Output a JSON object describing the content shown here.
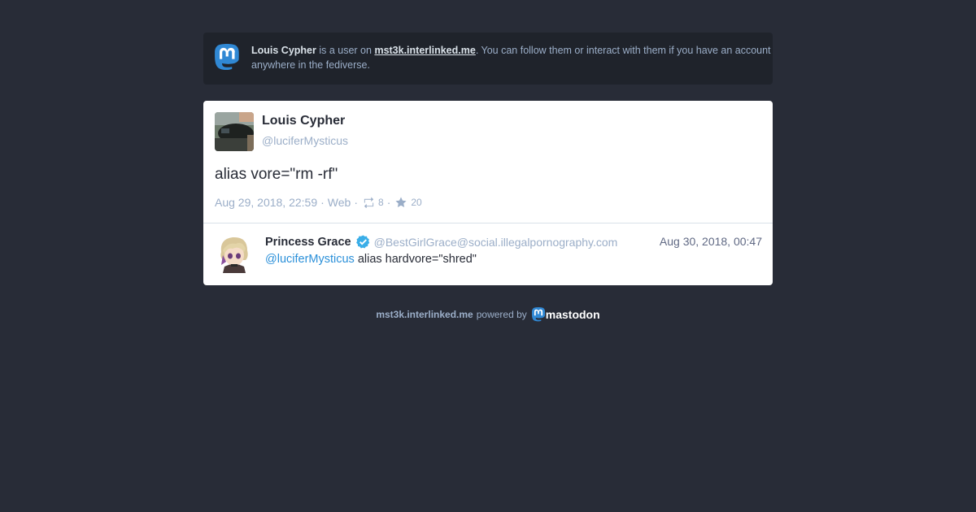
{
  "notice": {
    "name": "Louis Cypher",
    "text_middle": " is a user on ",
    "domain": "mst3k.interlinked.me",
    "text_end": ". You can follow them or interact with them if you have an account anywhere in the fediverse.",
    "icon": "mastodon-logo-icon"
  },
  "status": {
    "display_name": "Louis Cypher",
    "acct": "@luciferMysticus",
    "content": "alias vore=\"rm -rf\"",
    "date": "Aug 29, 2018, 22:59",
    "app": "Web",
    "boosts": "8",
    "favourites": "20",
    "separator": "·"
  },
  "reply": {
    "display_name": "Princess Grace",
    "acct": "@BestGirlGrace@social.illegalpornography.com",
    "time": "Aug 30, 2018, 00:47",
    "mention": "@luciferMysticus",
    "content_rest": " alias hardvore=\"shred\""
  },
  "footer": {
    "domain": "mst3k.interlinked.me",
    "powered_by": "powered by",
    "brand": "mastodon"
  },
  "colors": {
    "background": "#282c37",
    "notice_bg": "#1f232b",
    "link_blue": "#2b90d9",
    "verified_blue": "#3aaee8",
    "muted": "#9baec8"
  }
}
